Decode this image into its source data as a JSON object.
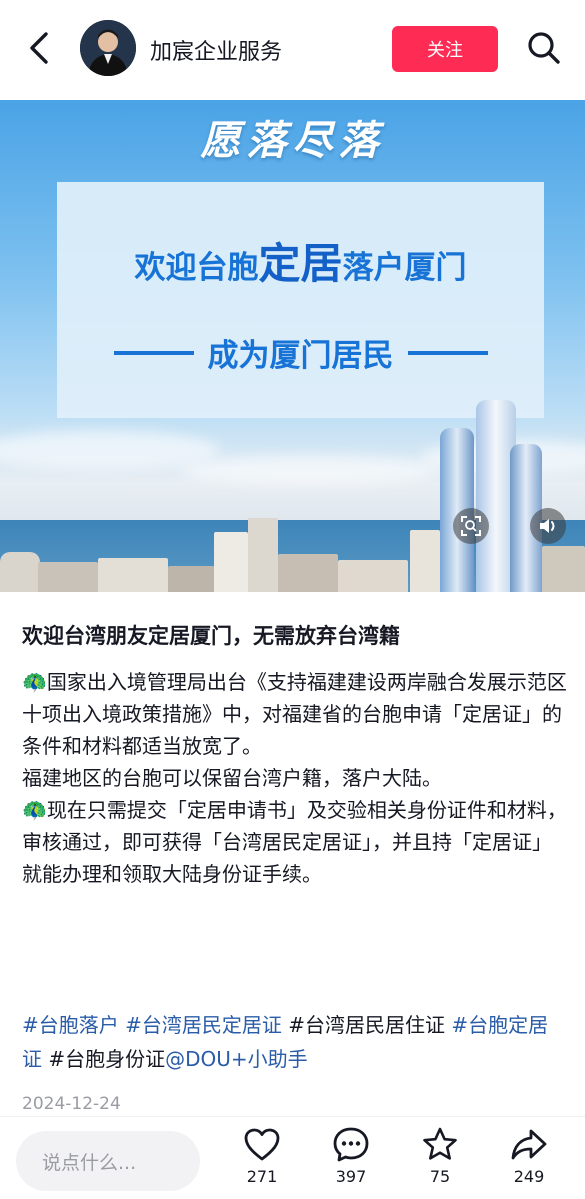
{
  "header": {
    "account_name": "加宸企业服务",
    "follow_label": "关注"
  },
  "media": {
    "banner_top": "愿落尽落",
    "banner_line1_a": "欢迎台胞",
    "banner_line1_b": "定居",
    "banner_line1_c": "落户厦门",
    "banner_line2": "成为厦门居民"
  },
  "post": {
    "title": "欢迎台湾朋友定居厦门，无需放弃台湾籍",
    "paragraphs": [
      "🦚国家出入境管理局出台《支持福建建设两岸融合发展示范区十项出入境政策措施》中，对福建省的台胞申请「定居证」的条件和材料都适当放宽了。",
      "福建地区的台胞可以保留台湾户籍，落户大陆。",
      "🦚现在只需提交「定居申请书」及交验相关身份证件和材料，审核通过，即可获得「台湾居民定居证」，并且持「定居证」就能办理和领取大陆身份证手续。"
    ],
    "hashtags": [
      "#台胞落户",
      "#台湾居民定居证",
      "#台湾居民居住证",
      "#台胞定居证",
      "#台胞身份证",
      "@DOU+小助手"
    ],
    "date": "2024-12-24"
  },
  "bottom_bar": {
    "comment_placeholder": "说点什么...",
    "likes": "271",
    "comments": "397",
    "collects": "75",
    "shares": "249"
  },
  "colors": {
    "accent": "#fe2c55",
    "hashtag": "#2a5ca8",
    "banner_text": "#1773d6"
  }
}
